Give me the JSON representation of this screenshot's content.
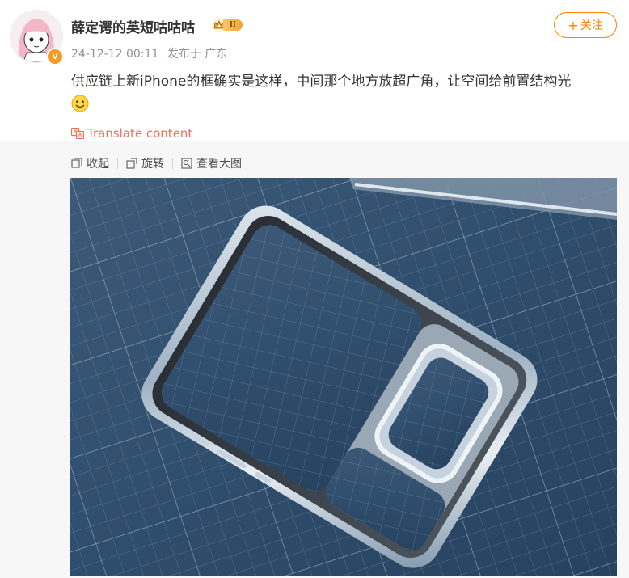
{
  "user": {
    "name": "薛定谔的英短咕咕咕",
    "verified_badge": "V",
    "vip_level": "II"
  },
  "follow_button": {
    "plus": "+",
    "label": "关注"
  },
  "post": {
    "date": "24-12-12 00:11",
    "source": "发布于 广东",
    "text": "供应链上新iPhone的框确实是这样，中间那个地方放超广角，让空间给前置结构光",
    "translate": "Translate content"
  },
  "toolbar": {
    "collapse": "收起",
    "rotate": "旋转",
    "view_large": "查看大图"
  },
  "colors": {
    "accent": "#ff8200",
    "translate": "#eb7350",
    "text": "#333333",
    "muted": "#939393"
  }
}
